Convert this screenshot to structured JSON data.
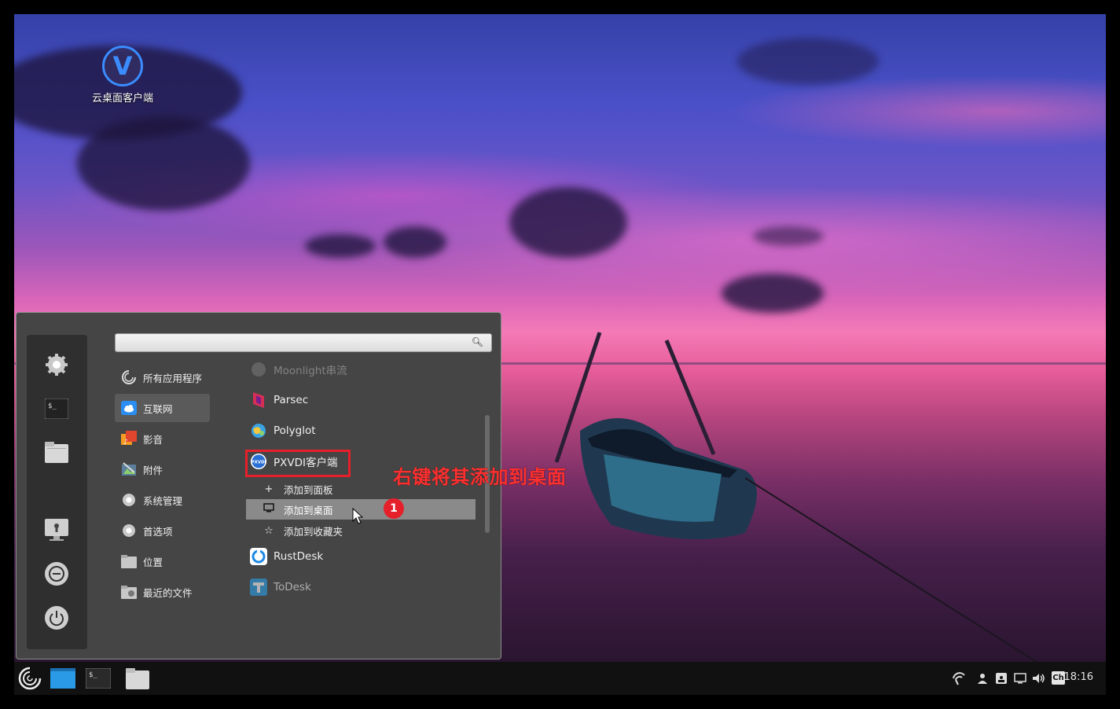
{
  "desktop": {
    "icon_label": "云桌面客户端",
    "icon_letter": "V"
  },
  "menu": {
    "search": {
      "value": "",
      "placeholder": ""
    },
    "categories": [
      {
        "label": "所有应用程序",
        "icon": "all-apps-icon"
      },
      {
        "label": "互联网",
        "icon": "internet-cloud-icon",
        "selected": true
      },
      {
        "label": "影音",
        "icon": "multimedia-icon"
      },
      {
        "label": "附件",
        "icon": "accessories-icon"
      },
      {
        "label": "系统管理",
        "icon": "system-gear-icon"
      },
      {
        "label": "首选项",
        "icon": "preferences-gear-icon"
      },
      {
        "label": "位置",
        "icon": "folder-icon"
      },
      {
        "label": "最近的文件",
        "icon": "recent-folder-icon"
      }
    ],
    "apps": [
      {
        "label": "Moonlight串流",
        "icon": "moonlight-icon"
      },
      {
        "label": "Parsec",
        "icon": "parsec-icon"
      },
      {
        "label": "Polyglot",
        "icon": "polyglot-globe-icon"
      },
      {
        "label": "PXVDI客户端",
        "icon": "pxvdi-icon",
        "icon_text": "PXVDI"
      },
      {
        "label": "RustDesk",
        "icon": "rustdesk-icon"
      },
      {
        "label": "ToDesk",
        "icon": "todesk-icon"
      }
    ],
    "context": [
      {
        "label": "添加到面板",
        "icon": "plus-icon",
        "glyph": "+"
      },
      {
        "label": "添加到桌面",
        "icon": "desktop-monitor-icon",
        "glyph": "🖵"
      },
      {
        "label": "添加到收藏夹",
        "icon": "star-icon",
        "glyph": "☆"
      }
    ]
  },
  "annotation": {
    "text": "右键将其添加到桌面",
    "badge": "1",
    "color": "#e5202a"
  },
  "taskbar": {
    "clock": "18:16",
    "lang": "Ch"
  }
}
